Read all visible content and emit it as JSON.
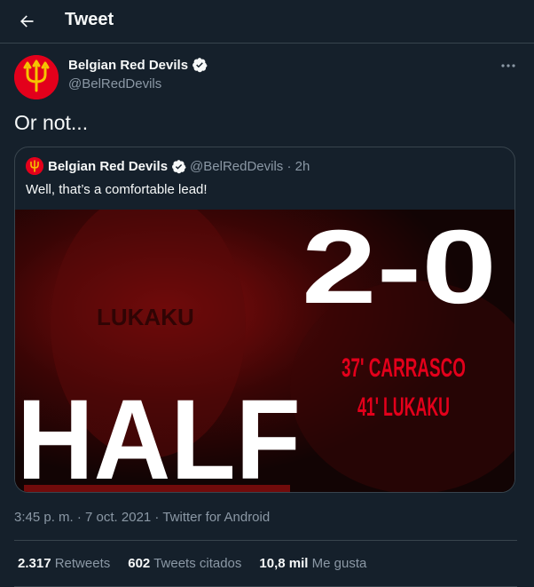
{
  "header": {
    "title": "Tweet"
  },
  "tweet": {
    "author_name": "Belgian Red Devils",
    "author_handle": "@BelRedDevils",
    "text": "Or not...",
    "timestamp": "3:45 p. m. · 7 oct. 2021 · Twitter for Android"
  },
  "quoted": {
    "author_name": "Belgian Red Devils",
    "meta": "@BelRedDevils · 2h",
    "text": "Well, that’s a comfortable lead!",
    "media": {
      "score": "2-0",
      "scorer1": "37' CARRASCO",
      "scorer2": "41' LUKAKU",
      "big_word": "HALF",
      "shirt": "LUKAKU"
    }
  },
  "stats": {
    "retweets_count": "2.317",
    "retweets_label": "Retweets",
    "quotes_count": "602",
    "quotes_label": "Tweets citados",
    "likes_count": "10,8 mil",
    "likes_label": "Me gusta"
  },
  "icons": {
    "back": "arrow-left-icon",
    "verified": "verified-badge-icon",
    "more": "more-horizontal-icon"
  },
  "colors": {
    "background": "#15202b",
    "border": "#38444d",
    "secondary_text": "#8b98a5",
    "brand_red": "#e3001b",
    "verified": "#f7f9f9"
  }
}
